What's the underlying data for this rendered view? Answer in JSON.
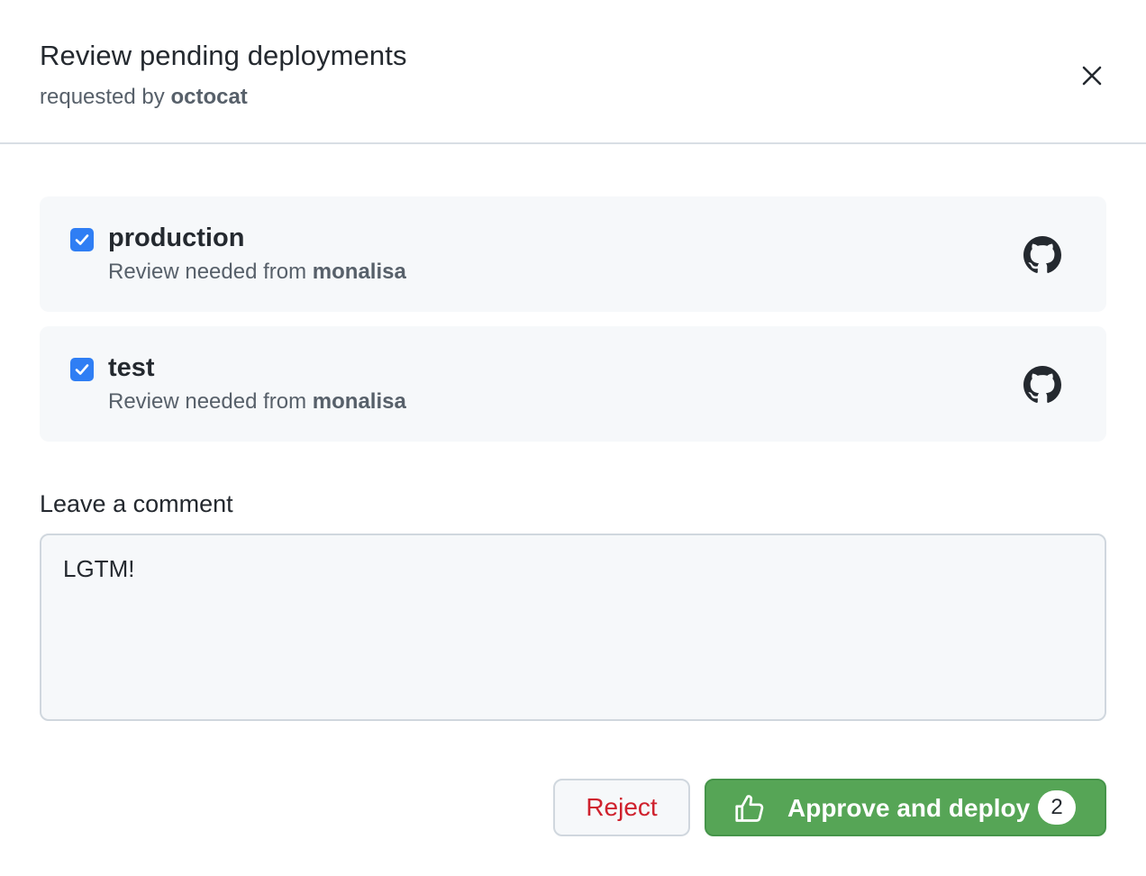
{
  "dialog": {
    "title": "Review pending deployments",
    "subtitle_prefix": "requested by",
    "requester": "octocat"
  },
  "environments": [
    {
      "name": "production",
      "checked": true,
      "desc_prefix": "Review needed from",
      "reviewer": "monalisa",
      "icon": "github-icon"
    },
    {
      "name": "test",
      "checked": true,
      "desc_prefix": "Review needed from",
      "reviewer": "monalisa",
      "icon": "github-icon"
    }
  ],
  "comment": {
    "label": "Leave a comment",
    "value": "LGTM!"
  },
  "actions": {
    "reject_label": "Reject",
    "approve_label": "Approve and deploy",
    "approve_count": "2"
  },
  "colors": {
    "checkbox": "#2f7ef4",
    "approve_bg": "#56a556",
    "reject_text": "#cf222e",
    "card_bg": "#f6f8fa"
  }
}
